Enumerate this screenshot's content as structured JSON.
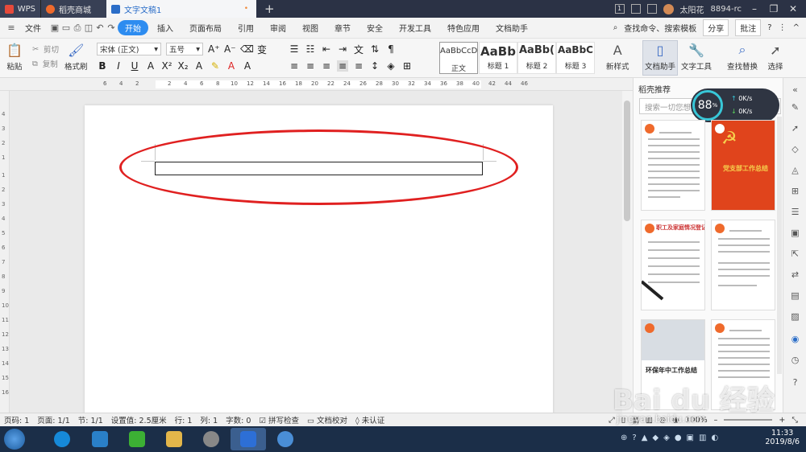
{
  "titlebar": {
    "tabs": [
      {
        "label": "WPS"
      },
      {
        "label": "稻壳商城"
      },
      {
        "label": "文字文稿1",
        "modified": "•"
      }
    ],
    "new_tab": "+",
    "page_indicator": "1",
    "user_name": "太阳花",
    "user_id": "8894-rc"
  },
  "menu": {
    "file": "文件",
    "items": [
      "开始",
      "插入",
      "页面布局",
      "引用",
      "审阅",
      "视图",
      "章节",
      "安全",
      "开发工具",
      "特色应用",
      "文档助手"
    ],
    "search": "查找命令、搜索模板",
    "share": "分享",
    "annotate": "批注",
    "help": "?"
  },
  "ribbon": {
    "paste": "粘贴",
    "cut": "剪切",
    "copy": "复制",
    "format_painter": "格式刷",
    "font_name": "宋体 (正文)",
    "font_size": "五号",
    "styles": [
      {
        "sample": "AaBbCcDd",
        "label": "正文"
      },
      {
        "sample": "AaBb",
        "label": "标题 1"
      },
      {
        "sample": "AaBb(",
        "label": "标题 2"
      },
      {
        "sample": "AaBbC",
        "label": "标题 3"
      }
    ],
    "new_style": "新样式",
    "doc_assistant": "文档助手",
    "text_tools": "文字工具",
    "find_replace": "查找替换",
    "select": "选择"
  },
  "ruler": {
    "numbers": [
      "6",
      "4",
      "2",
      "2",
      "4",
      "6",
      "8",
      "10",
      "12",
      "14",
      "16",
      "18",
      "20",
      "22",
      "24",
      "26",
      "28",
      "30",
      "32",
      "34",
      "36",
      "38",
      "40",
      "42",
      "44",
      "46"
    ],
    "vnumbers": [
      "4",
      "3",
      "2",
      "1",
      "1",
      "2",
      "3",
      "4",
      "5",
      "6",
      "7",
      "8",
      "9",
      "10",
      "11",
      "12",
      "13",
      "14",
      "15",
      "16"
    ]
  },
  "panel": {
    "title": "稻壳推荐",
    "search_placeholder": "搜索一切您想要",
    "speed": "88",
    "speed_unit": "%",
    "up": "0K/s",
    "down": "0K/s",
    "thumb2_title": "党支部工作总结",
    "thumb3_title": "职工及家庭情况登记表",
    "thumb5_title": "环保年中工作总结"
  },
  "status": {
    "page_no": "页码: 1",
    "pages": "页面: 1/1",
    "section": "节: 1/1",
    "setting": "设置值: 2.5厘米",
    "row": "行: 1",
    "col": "列: 1",
    "words": "字数: 0",
    "spell": "拼写检查",
    "proof": "文档校对",
    "cert": "未认证",
    "zoom": "100%"
  },
  "taskbar": {
    "time": "11:33",
    "date": "2019/8/6"
  },
  "watermark": {
    "text": "Bai du 经验",
    "url": "jingyan.baidu.com"
  },
  "colors": {
    "accent": "#2d8cf0",
    "ellipse": "#e02020"
  }
}
